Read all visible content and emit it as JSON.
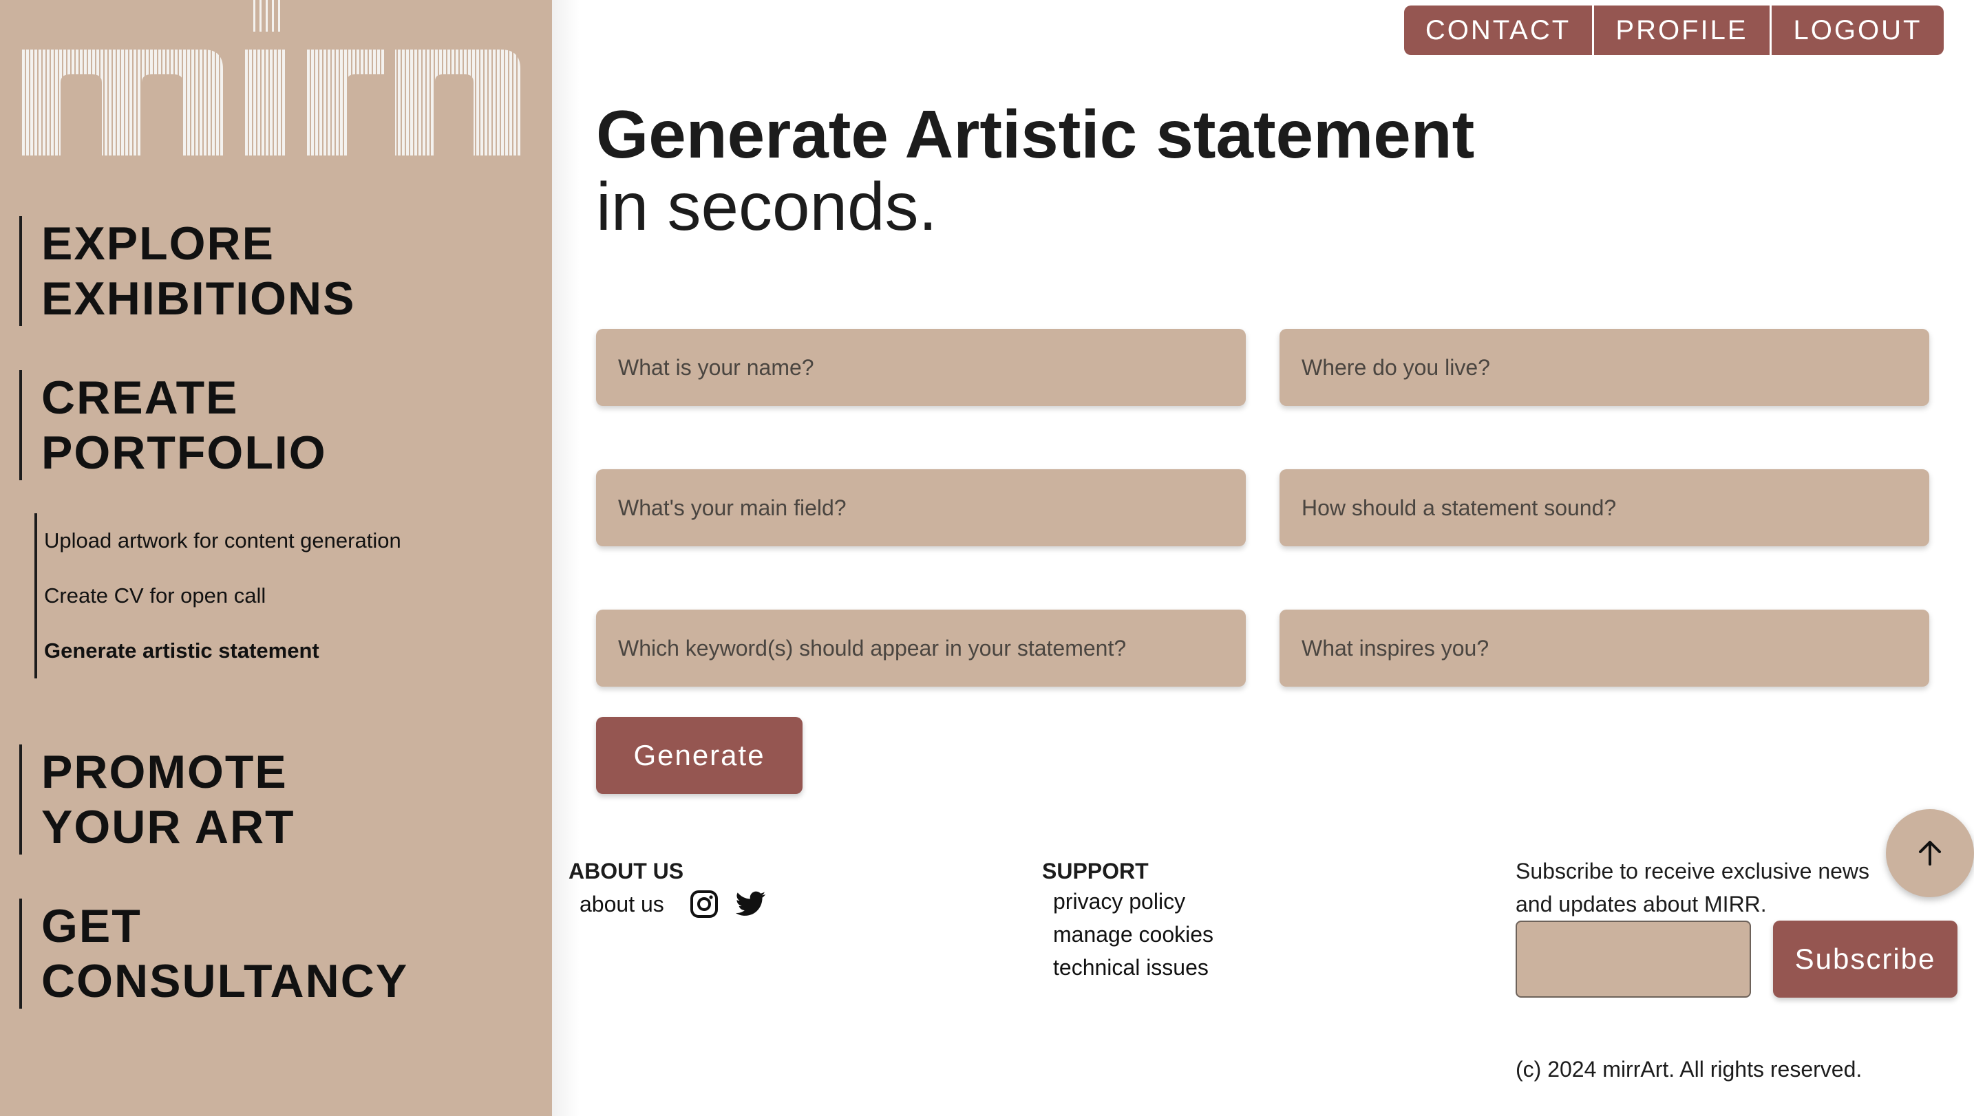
{
  "brand": {
    "logo_text": "mirr",
    "colors": {
      "sidebar": "#cbb29e",
      "accent": "#955651",
      "text": "#1c1c1c",
      "background": "#ffffff"
    }
  },
  "sidebar": {
    "nav": [
      {
        "line1": "EXPLORE",
        "line2": "EXHIBITIONS"
      },
      {
        "line1": "CREATE",
        "line2": "PORTFOLIO"
      },
      {
        "line1": "PROMOTE",
        "line2": "YOUR ART"
      },
      {
        "line1": "GET",
        "line2": "CONSULTANCY"
      }
    ],
    "subnav": [
      {
        "label": "Upload artwork for content generation",
        "active": false
      },
      {
        "label": "Create CV for open call",
        "active": false
      },
      {
        "label": "Generate artistic statement",
        "active": true
      }
    ]
  },
  "topnav": {
    "contact": "CONTACT",
    "profile": "PROFILE",
    "logout": "LOGOUT"
  },
  "heading": {
    "line1": "Generate Artistic statement",
    "line2": "in seconds."
  },
  "form": {
    "fields": [
      {
        "placeholder": "What is your name?",
        "value": ""
      },
      {
        "placeholder": "Where do you live?",
        "value": ""
      },
      {
        "placeholder": "What's your main field?",
        "value": ""
      },
      {
        "placeholder": "How should a statement sound?",
        "value": ""
      },
      {
        "placeholder": "Which keyword(s) should appear in your statement?",
        "value": ""
      },
      {
        "placeholder": "What inspires you?",
        "value": ""
      }
    ],
    "generate_label": "Generate"
  },
  "footer": {
    "about": {
      "heading": "ABOUT US",
      "link": "about us",
      "icons": [
        "instagram-icon",
        "twitter-icon"
      ]
    },
    "support": {
      "heading": "SUPPORT",
      "links": [
        "privacy policy",
        "manage cookies",
        "technical issues"
      ]
    },
    "subscribe": {
      "text": "Subscribe to receive exclusive news and updates about MIRR.",
      "input_value": "",
      "button_label": "Subscribe"
    },
    "copyright": "(c) 2024 mirrArt. All rights reserved."
  },
  "scroll_top_icon": "arrow-up-icon"
}
